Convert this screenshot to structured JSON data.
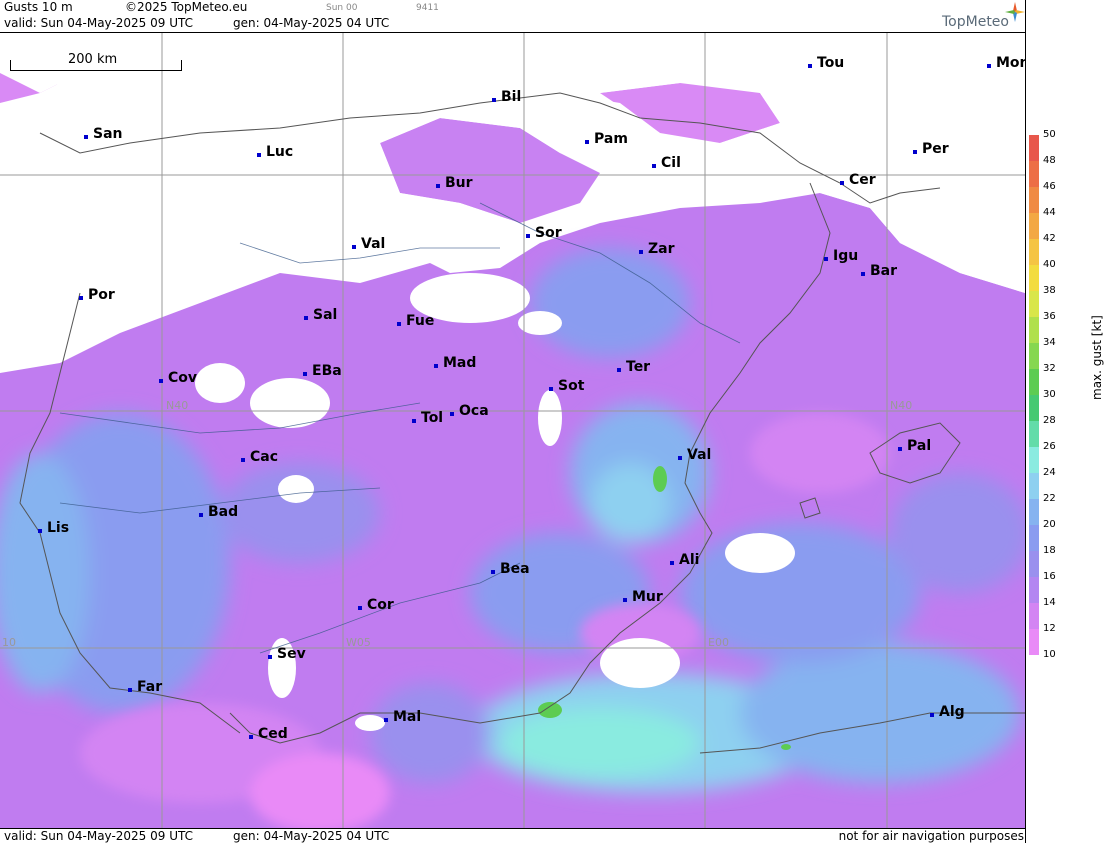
{
  "header": {
    "title": "Gusts 10 m",
    "copyright": "©2025 TopMeteo.eu",
    "run": "Sun 00",
    "code": "9411",
    "valid": "valid:  Sun  04-May-2025  09 UTC",
    "gen": "gen: 04-May-2025 04 UTC",
    "brand": "TopMeteo"
  },
  "footer": {
    "valid": "valid:  Sun  04-May-2025  09 UTC",
    "gen": "gen: 04-May-2025 04 UTC",
    "disclaimer": "not for air navigation purposes"
  },
  "scale_bar": {
    "label": "200 km"
  },
  "grid_labels": {
    "n40_left": "N40",
    "n40_right": "N40",
    "w05": "W05",
    "e00": "E00",
    "w10": "10"
  },
  "legend": {
    "title": "max. gust  [kt]",
    "ticks": [
      "50",
      "48",
      "46",
      "44",
      "42",
      "40",
      "38",
      "36",
      "34",
      "32",
      "30",
      "28",
      "26",
      "24",
      "22",
      "20",
      "18",
      "16",
      "14",
      "12",
      "10"
    ],
    "colors": [
      "#e8574b",
      "#ed6e45",
      "#f08a43",
      "#f3a844",
      "#f5c443",
      "#f3dc3f",
      "#d9e64a",
      "#b0e04d",
      "#86d750",
      "#5dcc52",
      "#46c972",
      "#63dca9",
      "#8aebe0",
      "#8ed0f0",
      "#86b3f0",
      "#8a9cf0",
      "#9a90ee",
      "#b386f1",
      "#d384f3",
      "#e98af7"
    ]
  },
  "cities": [
    {
      "name": "Bil"
    },
    {
      "name": "Tou"
    },
    {
      "name": "Mon"
    },
    {
      "name": "San"
    },
    {
      "name": "Luc"
    },
    {
      "name": "Pam"
    },
    {
      "name": "Bur"
    },
    {
      "name": "Cil"
    },
    {
      "name": "Per"
    },
    {
      "name": "Cer"
    },
    {
      "name": "Val"
    },
    {
      "name": "Sor"
    },
    {
      "name": "Zar"
    },
    {
      "name": "Igu"
    },
    {
      "name": "Bar"
    },
    {
      "name": "Por"
    },
    {
      "name": "Sal"
    },
    {
      "name": "Fue"
    },
    {
      "name": "Cov"
    },
    {
      "name": "EBa"
    },
    {
      "name": "Mad"
    },
    {
      "name": "Sot"
    },
    {
      "name": "Ter"
    },
    {
      "name": "Tol"
    },
    {
      "name": "Oca"
    },
    {
      "name": "Pal"
    },
    {
      "name": "Cac"
    },
    {
      "name": "Val"
    },
    {
      "name": "Lis"
    },
    {
      "name": "Bad"
    },
    {
      "name": "Bea"
    },
    {
      "name": "Ali"
    },
    {
      "name": "Cor"
    },
    {
      "name": "Mur"
    },
    {
      "name": "Sev"
    },
    {
      "name": "Far"
    },
    {
      "name": "Mal"
    },
    {
      "name": "Alg"
    },
    {
      "name": "Ced"
    }
  ]
}
